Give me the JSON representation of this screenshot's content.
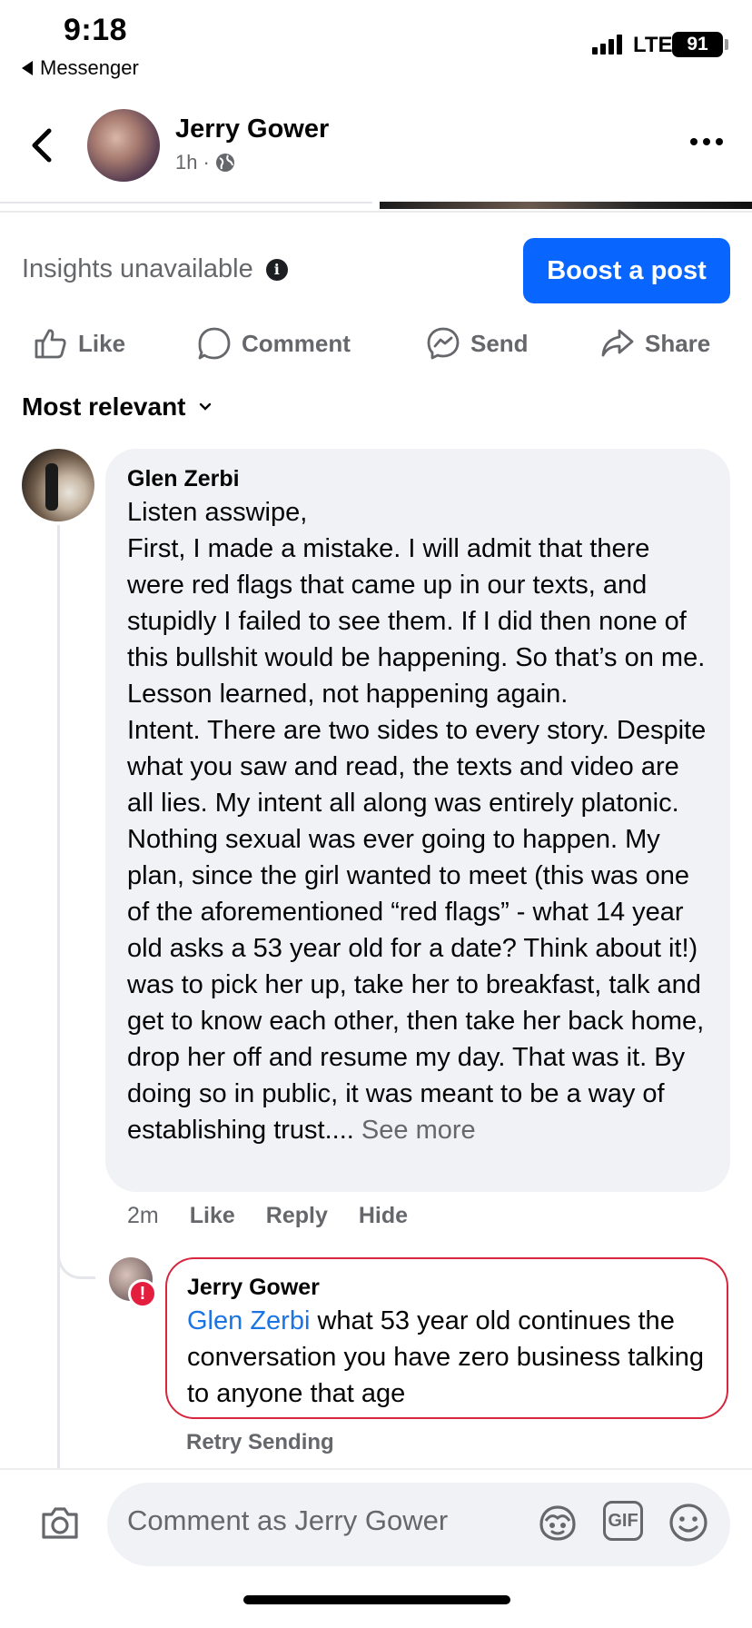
{
  "status_bar": {
    "time": "9:18",
    "back_app": "Messenger",
    "network": "LTE",
    "battery": "91"
  },
  "header": {
    "name": "Jerry Gower",
    "time_ago": "1h",
    "separator": "·"
  },
  "insights": {
    "label": "Insights unavailable",
    "info": "i"
  },
  "boost_button": "Boost a post",
  "actions": {
    "like": "Like",
    "comment": "Comment",
    "send": "Send",
    "share": "Share"
  },
  "sort": {
    "label": "Most relevant"
  },
  "comment": {
    "author": "Glen Zerbi",
    "text": "Listen asswipe,\nFirst, I made a mistake. I will admit that there were red flags that came up in our texts, and stupidly I failed to see them. If I did then none of this bullshit would be happening. So that’s on me. Lesson learned, not happening again.\nIntent. There are two sides to every story. Despite what you saw and read, the texts and video are all lies. My intent all along was entirely platonic. Nothing sexual was ever going to happen. My plan, since the girl wanted to meet (this was one of the aforementioned “red flags” - what 14 year old asks a 53 year old for a date? Think about it!) was to pick her up, take her to breakfast, talk and get to know each other, then take her back home, drop her off and resume my day. That was it. By doing so in public, it was meant to be a way of establishing trust....",
    "see_more": "See more",
    "time_ago": "2m",
    "like": "Like",
    "reply": "Reply",
    "hide": "Hide"
  },
  "reply": {
    "author": "Jerry Gower",
    "mention": "Glen Zerbi",
    "text": " what 53 year old continues the conversation you have zero business talking to anyone that age",
    "error_badge": "!",
    "retry": "Retry Sending"
  },
  "composer": {
    "placeholder": "Comment as Jerry Gower",
    "gif": "GIF"
  },
  "icons": [
    "back-chevron-icon",
    "globe-icon",
    "more-icon",
    "info-icon",
    "like-icon",
    "comment-icon",
    "messenger-icon",
    "share-icon",
    "chevron-down-icon",
    "camera-icon",
    "avatar-sticker-icon",
    "gif-icon",
    "emoji-icon"
  ],
  "colors": {
    "primary": "#0866ff",
    "error": "#e41e3f",
    "mention": "#1b74e4",
    "secondary_text": "#65676b",
    "bubble_bg": "#f0f2f5"
  }
}
